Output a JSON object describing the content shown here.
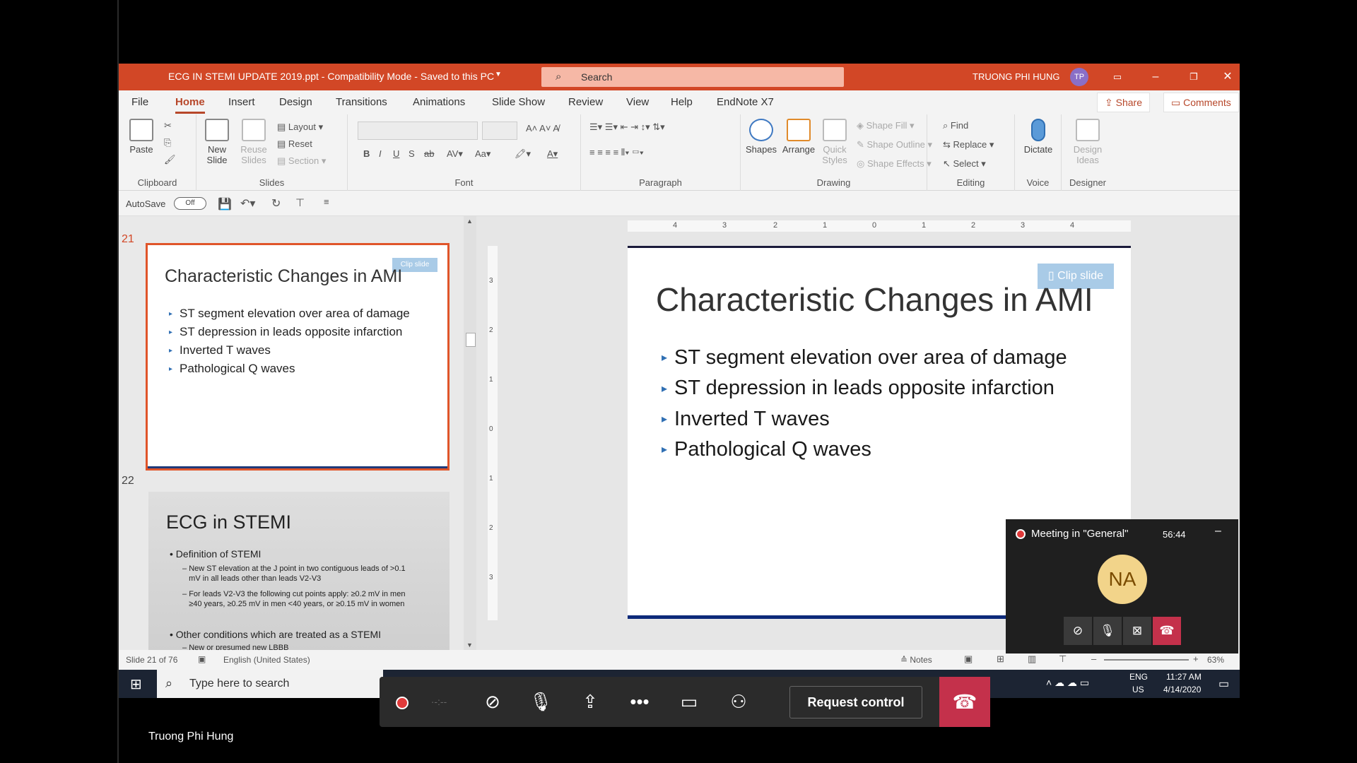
{
  "window": {
    "title": "ECG IN STEMI UPDATE 2019.ppt  -  Compatibility Mode  -  Saved to this PC",
    "search_placeholder": "Search",
    "user_name": "TRUONG PHI HUNG",
    "user_initials": "TP"
  },
  "menu": {
    "tabs": [
      "File",
      "Home",
      "Insert",
      "Design",
      "Transitions",
      "Animations",
      "Slide Show",
      "Review",
      "View",
      "Help",
      "EndNote X7"
    ],
    "share": "Share",
    "comments": "Comments"
  },
  "ribbon": {
    "clipboard": {
      "paste": "Paste",
      "label": "Clipboard"
    },
    "slides": {
      "new_slide": "New Slide",
      "reuse": "Reuse Slides",
      "layout": "Layout",
      "reset": "Reset",
      "section": "Section",
      "label": "Slides"
    },
    "font": {
      "label": "Font"
    },
    "paragraph": {
      "label": "Paragraph"
    },
    "drawing": {
      "shapes": "Shapes",
      "arrange": "Arrange",
      "quick_styles": "Quick Styles",
      "shape_fill": "Shape Fill",
      "shape_outline": "Shape Outline",
      "shape_effects": "Shape Effects",
      "label": "Drawing"
    },
    "editing": {
      "find": "Find",
      "replace": "Replace",
      "select": "Select",
      "label": "Editing"
    },
    "voice": {
      "dictate": "Dictate",
      "label": "Voice"
    },
    "designer": {
      "design_ideas": "Design Ideas",
      "label": "Designer"
    }
  },
  "qat": {
    "autosave": "AutoSave",
    "toggle": "Off"
  },
  "thumbnails": [
    {
      "number": "21",
      "title": "Characteristic Changes in AMI",
      "clip": "Clip slide",
      "bullets": [
        "ST segment elevation over area of damage",
        "ST depression in leads opposite infarction",
        "Inverted T waves",
        "Pathological Q waves"
      ]
    },
    {
      "number": "22",
      "title": "ECG in STEMI",
      "b1": "Definition of STEMI",
      "s1a": "New ST elevation at the J point in two contiguous leads of >0.1",
      "s1b": "mV in all leads other than leads V2-V3",
      "s2a": "For leads V2-V3 the following cut points apply: ≥0.2 mV in men",
      "s2b": "≥40 years, ≥0.25 mV in men <40 years, or ≥0.15 mV in women",
      "b2": "Other conditions which are treated as a STEMI",
      "s3": "New or presumed new LBBB"
    }
  ],
  "main_slide": {
    "title": "Characteristic Changes in AMI",
    "clip": "Clip slide",
    "bullets": [
      "ST segment elevation over area of damage",
      "ST depression in leads opposite infarction",
      "Inverted T waves",
      "Pathological Q waves"
    ]
  },
  "ruler": {
    "h_ticks": [
      "4",
      "3",
      "2",
      "1",
      "0",
      "1",
      "2",
      "3",
      "4"
    ],
    "v_ticks": [
      "3",
      "2",
      "1",
      "0",
      "1",
      "2",
      "3"
    ]
  },
  "status": {
    "slide": "Slide 21 of 76",
    "language": "English (United States)",
    "notes": "Notes",
    "zoom": "63%"
  },
  "taskbar": {
    "search_placeholder": "Type here to search",
    "lang1": "ENG",
    "lang2": "US",
    "time": "11:27 AM",
    "date": "4/14/2020"
  },
  "teams": {
    "request_control": "Request control"
  },
  "meeting": {
    "title": "Meeting in \"General\"",
    "duration": "56:44",
    "initials": "NA"
  },
  "presenter_name": "Truong Phi Hung"
}
